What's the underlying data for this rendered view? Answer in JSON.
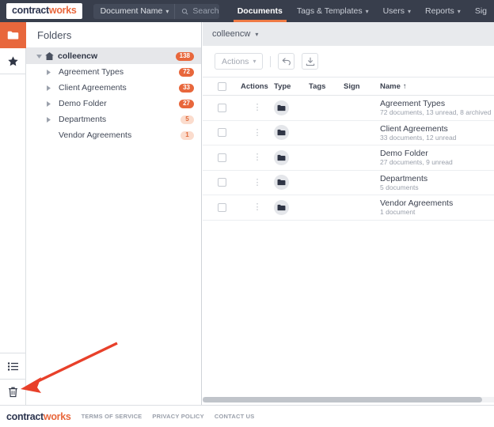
{
  "brand": {
    "name_a": "contract",
    "name_b": "works",
    "orange": "#e8673c",
    "navy": "#383e4c"
  },
  "topnav": {
    "search": {
      "selector_label": "Document Name",
      "placeholder": "Search",
      "value": "",
      "icon": "search-icon"
    },
    "links": [
      {
        "label": "Documents",
        "active": true,
        "has_caret": false
      },
      {
        "label": "Tags & Templates",
        "active": false,
        "has_caret": true
      },
      {
        "label": "Users",
        "active": false,
        "has_caret": true
      },
      {
        "label": "Reports",
        "active": false,
        "has_caret": true
      },
      {
        "label": "Sig",
        "active": false,
        "has_caret": false
      }
    ]
  },
  "rail": {
    "top": [
      {
        "icon": "folder-icon",
        "name": "rail-item-folders",
        "active": true
      },
      {
        "icon": "star-icon",
        "name": "rail-item-favorites",
        "active": false
      }
    ],
    "bottom": [
      {
        "icon": "list-icon",
        "name": "rail-item-list",
        "active": false
      },
      {
        "icon": "trash-icon",
        "name": "rail-item-trash",
        "active": false
      }
    ]
  },
  "folders": {
    "title": "Folders",
    "tree": [
      {
        "label": "colleencw",
        "count": "138",
        "pale": false,
        "root": true,
        "twisty": "down",
        "indent": 10
      },
      {
        "label": "Agreement Types",
        "count": "72",
        "pale": false,
        "root": false,
        "twisty": "right",
        "indent": 22
      },
      {
        "label": "Client Agreements",
        "count": "33",
        "pale": false,
        "root": false,
        "twisty": "right",
        "indent": 22
      },
      {
        "label": "Demo Folder",
        "count": "27",
        "pale": false,
        "root": false,
        "twisty": "right",
        "indent": 22
      },
      {
        "label": "Departments",
        "count": "5",
        "pale": true,
        "root": false,
        "twisty": "right",
        "indent": 22
      },
      {
        "label": "Vendor Agreements",
        "count": "1",
        "pale": true,
        "root": false,
        "twisty": "none",
        "indent": 22
      }
    ]
  },
  "main": {
    "breadcrumb": "colleencw",
    "toolbar": {
      "actions_label": "Actions",
      "undo_icon": "undo-arrow-icon",
      "download_icon": "download-icon"
    },
    "table": {
      "headers": {
        "actions": "Actions",
        "type": "Type",
        "tags": "Tags",
        "sign": "Sign",
        "name": "Name",
        "sort_arrow": "↑"
      },
      "rows": [
        {
          "name": "Agreement Types",
          "meta": "72 documents, 13 unread, 8 archived"
        },
        {
          "name": "Client Agreements",
          "meta": "33 documents, 12 unread"
        },
        {
          "name": "Demo Folder",
          "meta": "27 documents, 9 unread"
        },
        {
          "name": "Departments",
          "meta": "5 documents"
        },
        {
          "name": "Vendor Agreements",
          "meta": "1 document"
        }
      ]
    }
  },
  "footer": {
    "links": [
      "TERMS OF SERVICE",
      "PRIVACY POLICY",
      "CONTACT US"
    ]
  },
  "annotation": {
    "color": "#e8402a",
    "points_to": "rail-item-trash"
  }
}
